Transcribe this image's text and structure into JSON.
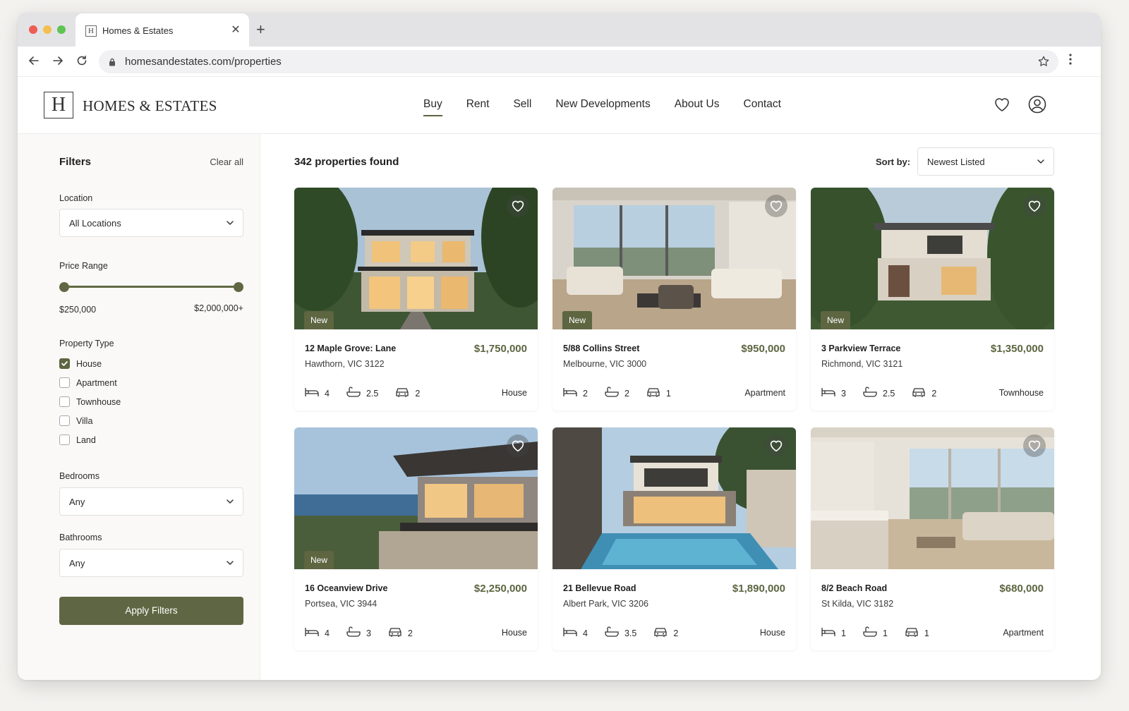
{
  "browser": {
    "tab_title": "Homes & Estates",
    "tab_favicon": "H",
    "url": "homesandestates.com/properties"
  },
  "site": {
    "logo_letter": "H",
    "logo_text": "HOMES & ESTATES",
    "nav": [
      "Buy",
      "Rent",
      "Sell",
      "New Developments",
      "About Us",
      "Contact"
    ],
    "active_nav": "Buy",
    "accent_color": "#5d6541"
  },
  "filters": {
    "title": "Filters",
    "clear_all": "Clear all",
    "location_label": "Location",
    "location_value": "All Locations",
    "price_label": "Price Range",
    "price_min": "$250,000",
    "price_max": "$2,000,000+",
    "type_label": "Property Type",
    "types": [
      {
        "label": "House",
        "checked": true
      },
      {
        "label": "Apartment",
        "checked": false
      },
      {
        "label": "Townhouse",
        "checked": false
      },
      {
        "label": "Villa",
        "checked": false
      },
      {
        "label": "Land",
        "checked": false
      }
    ],
    "bedrooms_label": "Bedrooms",
    "bedrooms_value": "Any",
    "bathrooms_label": "Bathrooms",
    "bathrooms_value": "Any",
    "apply_label": "Apply Filters"
  },
  "results": {
    "count_text": "342 properties found",
    "sort_label": "Sort by:",
    "sort_value": "Newest Listed"
  },
  "listings": [
    {
      "address": "12 Maple Grove: Lane",
      "price": "$1,750,000",
      "suburb": "Hawthorn, VIC 3122",
      "beds": "4",
      "baths": "2.5",
      "cars": "2",
      "type": "House",
      "badge": "New"
    },
    {
      "address": "5/88 Collins Street",
      "price": "$950,000",
      "suburb": "Melbourne, VIC 3000",
      "beds": "2",
      "baths": "2",
      "cars": "1",
      "type": "Apartment",
      "badge": "New"
    },
    {
      "address": "3 Parkview Terrace",
      "price": "$1,350,000",
      "suburb": "Richmond, VIC 3121",
      "beds": "3",
      "baths": "2.5",
      "cars": "2",
      "type": "Townhouse",
      "badge": "New"
    },
    {
      "address": "16 Oceanview Drive",
      "price": "$2,250,000",
      "suburb": "Portsea, VIC 3944",
      "beds": "4",
      "baths": "3",
      "cars": "2",
      "type": "House",
      "badge": "New"
    },
    {
      "address": "21 Bellevue Road",
      "price": "$1,890,000",
      "suburb": "Albert Park, VIC 3206",
      "beds": "4",
      "baths": "3.5",
      "cars": "2",
      "type": "House",
      "badge": ""
    },
    {
      "address": "8/2 Beach Road",
      "price": "$680,000",
      "suburb": "St Kilda, VIC 3182",
      "beds": "1",
      "baths": "1",
      "cars": "1",
      "type": "Apartment",
      "badge": ""
    }
  ]
}
